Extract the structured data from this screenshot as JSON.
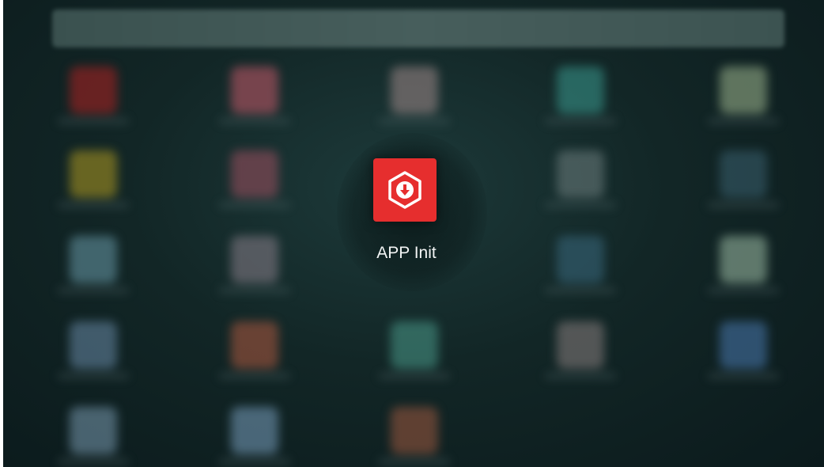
{
  "launcher": {
    "focused_app": {
      "label": "APP Init",
      "icon": "download-hexagon-icon",
      "color": "#e62e2e"
    },
    "background_tile_colors": [
      [
        "#b02020",
        "#c85a6a",
        "#a38a8a",
        "#3a9a90",
        "#a0b890"
      ],
      [
        "#b09a20",
        "#a05060",
        null,
        "#708080",
        "#3a6070"
      ],
      [
        "#6a9aaa",
        "#8a7f8a",
        null,
        "#3a6a80",
        "#a0c0a8"
      ],
      [
        "#6a8aa8",
        "#b05a40",
        "#4a9a8a",
        "#8a8080",
        "#4a7ab0"
      ],
      [
        "#7a9ab0",
        "#7aa0c0",
        "#a05a40",
        null,
        null
      ]
    ]
  }
}
